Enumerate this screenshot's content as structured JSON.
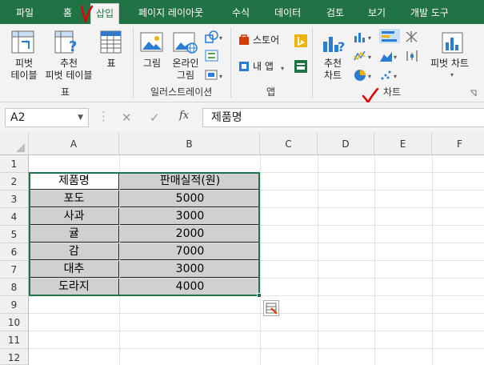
{
  "tabs": [
    {
      "label": "파일",
      "active": false
    },
    {
      "label": "홈",
      "active": false
    },
    {
      "label": "삽입",
      "active": true
    },
    {
      "label": "페이지 레이아웃",
      "active": false
    },
    {
      "label": "수식",
      "active": false
    },
    {
      "label": "데이터",
      "active": false
    },
    {
      "label": "검토",
      "active": false
    },
    {
      "label": "보기",
      "active": false
    },
    {
      "label": "개발 도구",
      "active": false
    }
  ],
  "ribbon": {
    "pivot_table": [
      "피벗",
      "테이블"
    ],
    "recommended_pivot": [
      "추천",
      "피벗 테이블"
    ],
    "table": "표",
    "picture": "그림",
    "online_picture": [
      "온라인",
      "그림"
    ],
    "store": "스토어",
    "my_apps": "내 앱",
    "recommended_charts": [
      "추천",
      "차트"
    ],
    "pivot_chart": "피벗 차트",
    "groups": {
      "tables": "표",
      "illustrations": "일러스트레이션",
      "addins": "앱",
      "charts": "차트"
    }
  },
  "formula_bar": {
    "name_box": "A2",
    "fx": "fx",
    "content": "제품명"
  },
  "columns": [
    "A",
    "B",
    "C",
    "D",
    "E",
    "F"
  ],
  "rows": [
    "1",
    "2",
    "3",
    "4",
    "5",
    "6",
    "7",
    "8",
    "9",
    "10",
    "11",
    "12"
  ],
  "table": {
    "headers": [
      "제품명",
      "판매실적(원)"
    ],
    "data": [
      [
        "포도",
        "5000"
      ],
      [
        "사과",
        "3000"
      ],
      [
        "귤",
        "2000"
      ],
      [
        "감",
        "7000"
      ],
      [
        "대추",
        "3000"
      ],
      [
        "도라지",
        "4000"
      ]
    ]
  },
  "colors": {
    "accent": "#217346",
    "annotation": "#e00000",
    "selection_fill": "#d0d0d0"
  }
}
